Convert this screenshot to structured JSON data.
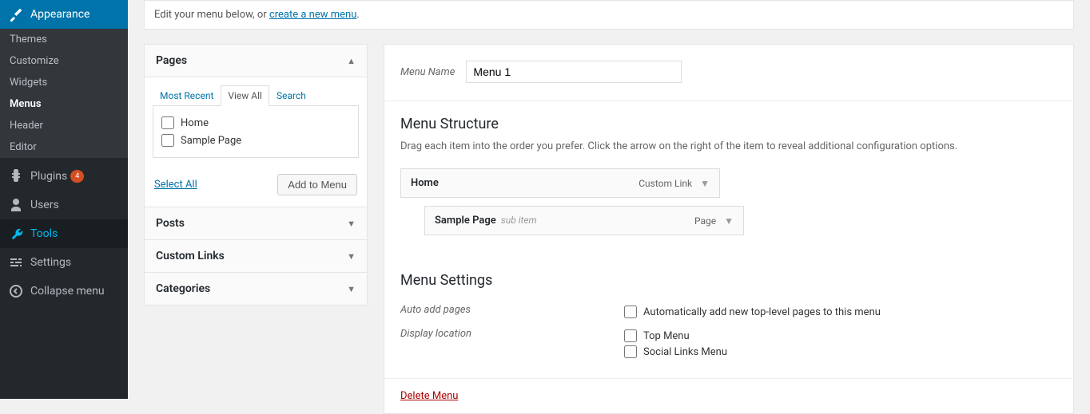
{
  "sidebar": {
    "appearance_label": "Appearance",
    "submenu": {
      "themes": "Themes",
      "customize": "Customize",
      "widgets": "Widgets",
      "menus": "Menus",
      "header": "Header",
      "editor": "Editor"
    },
    "plugins_label": "Plugins",
    "plugins_badge": "4",
    "users_label": "Users",
    "tools_label": "Tools",
    "settings_label": "Settings",
    "collapse_label": "Collapse menu"
  },
  "notice": {
    "prefix": "Edit your menu below, or ",
    "link": "create a new menu",
    "suffix": "."
  },
  "accordion": {
    "pages": {
      "title": "Pages",
      "tabs": {
        "recent": "Most Recent",
        "viewall": "View All",
        "search": "Search"
      },
      "items": {
        "home": "Home",
        "sample": "Sample Page"
      },
      "select_all": "Select All",
      "add_to_menu": "Add to Menu"
    },
    "posts": "Posts",
    "custom_links": "Custom Links",
    "categories": "Categories"
  },
  "menu": {
    "name_label": "Menu Name",
    "name_value": "Menu 1",
    "structure_heading": "Menu Structure",
    "structure_help": "Drag each item into the order you prefer. Click the arrow on the right of the item to reveal additional configuration options.",
    "items": [
      {
        "title": "Home",
        "subinfo": "",
        "type": "Custom Link"
      },
      {
        "title": "Sample Page",
        "subinfo": "sub item",
        "type": "Page"
      }
    ],
    "settings_heading": "Menu Settings",
    "auto_add_label": "Auto add pages",
    "auto_add_option": "Automatically add new top-level pages to this menu",
    "display_location_label": "Display location",
    "location_top": "Top Menu",
    "location_social": "Social Links Menu",
    "delete": "Delete Menu"
  }
}
